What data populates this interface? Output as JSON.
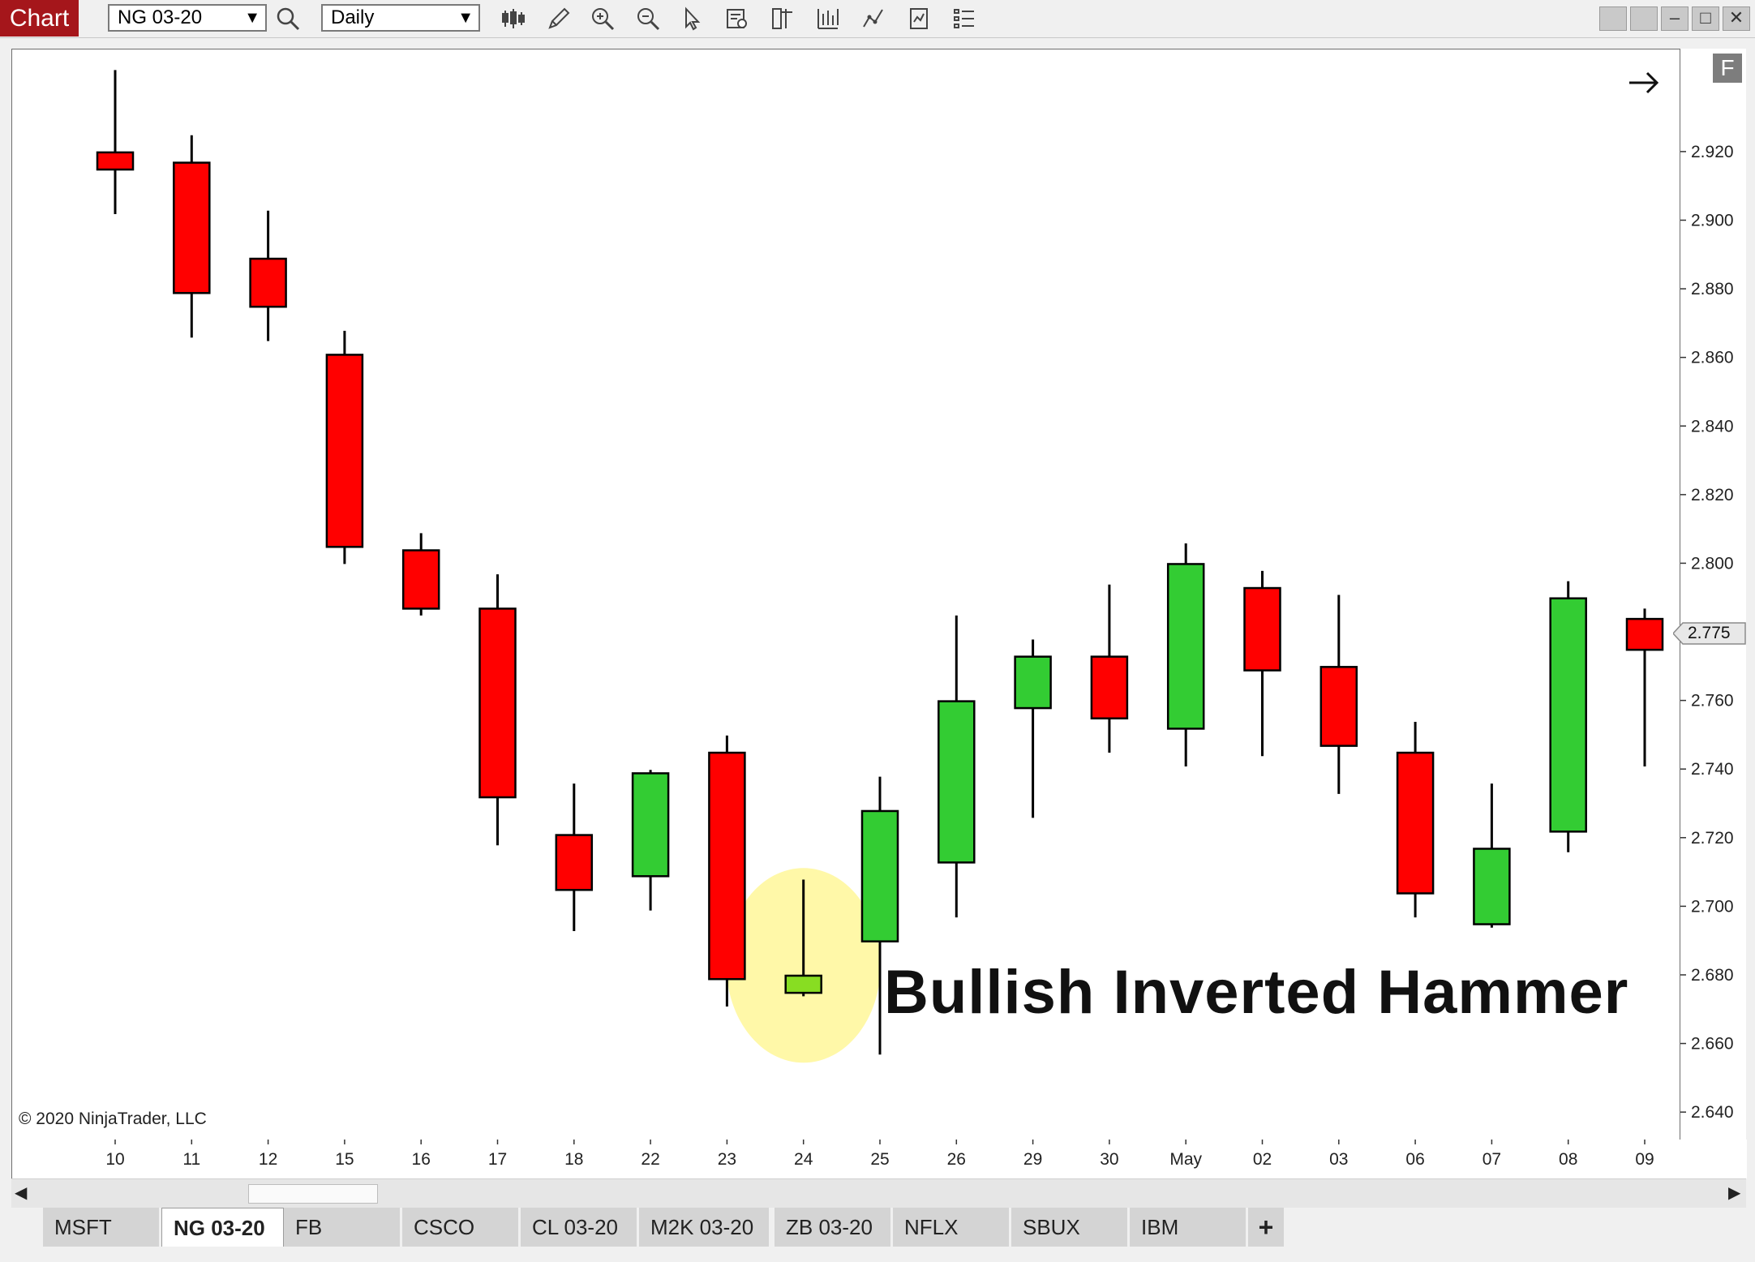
{
  "window": {
    "title_badge": "Chart",
    "instrument": "NG 03-20",
    "interval": "Daily"
  },
  "toolbar_icons": [
    "search-icon",
    "bar-type-icon",
    "pencil-icon",
    "zoom-in-icon",
    "zoom-out-icon",
    "pointer-icon",
    "data-box-icon",
    "chart-trader-icon",
    "indicators-icon",
    "strategies-icon",
    "templates-icon",
    "properties-icon"
  ],
  "window_controls": [
    "link-icon",
    "link-icon-2",
    "minimize-icon",
    "maximize-icon",
    "close-icon"
  ],
  "copyright": "© 2020 NinjaTrader, LLC",
  "f_badge": "F",
  "annotation": "Bullish Inverted Hammer",
  "last_price": "2.775",
  "colors": {
    "up": "#33cc33",
    "down": "#ff0000",
    "highlight_up": "#88dd22",
    "highlight_circle": "#fff799",
    "brand": "#a5161b"
  },
  "chart_data": {
    "type": "candlestick",
    "x_labels": [
      "10",
      "11",
      "12",
      "15",
      "16",
      "17",
      "18",
      "22",
      "23",
      "24",
      "25",
      "26",
      "29",
      "30",
      "May",
      "02",
      "03",
      "06",
      "07",
      "08",
      "09"
    ],
    "y_ticks": [
      "2.640",
      "2.660",
      "2.680",
      "2.700",
      "2.720",
      "2.740",
      "2.760",
      "2.780",
      "2.800",
      "2.820",
      "2.840",
      "2.860",
      "2.880",
      "2.900",
      "2.920"
    ],
    "ylim": [
      2.632,
      2.95
    ],
    "candles": [
      {
        "o": 2.92,
        "h": 2.944,
        "l": 2.902,
        "c": 2.915
      },
      {
        "o": 2.917,
        "h": 2.925,
        "l": 2.866,
        "c": 2.879
      },
      {
        "o": 2.889,
        "h": 2.903,
        "l": 2.865,
        "c": 2.875
      },
      {
        "o": 2.861,
        "h": 2.868,
        "l": 2.8,
        "c": 2.805
      },
      {
        "o": 2.804,
        "h": 2.809,
        "l": 2.785,
        "c": 2.787
      },
      {
        "o": 2.787,
        "h": 2.797,
        "l": 2.718,
        "c": 2.732
      },
      {
        "o": 2.721,
        "h": 2.736,
        "l": 2.693,
        "c": 2.705
      },
      {
        "o": 2.709,
        "h": 2.74,
        "l": 2.699,
        "c": 2.739
      },
      {
        "o": 2.745,
        "h": 2.75,
        "l": 2.671,
        "c": 2.679
      },
      {
        "o": 2.675,
        "h": 2.708,
        "l": 2.674,
        "c": 2.68,
        "highlight": true
      },
      {
        "o": 2.69,
        "h": 2.738,
        "l": 2.657,
        "c": 2.728
      },
      {
        "o": 2.713,
        "h": 2.785,
        "l": 2.697,
        "c": 2.76
      },
      {
        "o": 2.758,
        "h": 2.778,
        "l": 2.726,
        "c": 2.773
      },
      {
        "o": 2.773,
        "h": 2.794,
        "l": 2.745,
        "c": 2.755
      },
      {
        "o": 2.752,
        "h": 2.806,
        "l": 2.741,
        "c": 2.8
      },
      {
        "o": 2.793,
        "h": 2.798,
        "l": 2.744,
        "c": 2.769
      },
      {
        "o": 2.77,
        "h": 2.791,
        "l": 2.733,
        "c": 2.747
      },
      {
        "o": 2.745,
        "h": 2.754,
        "l": 2.697,
        "c": 2.704
      },
      {
        "o": 2.695,
        "h": 2.736,
        "l": 2.694,
        "c": 2.717
      },
      {
        "o": 2.722,
        "h": 2.795,
        "l": 2.716,
        "c": 2.79
      },
      {
        "o": 2.784,
        "h": 2.787,
        "l": 2.741,
        "c": 2.775
      }
    ]
  },
  "tabs": [
    {
      "label": "MSFT",
      "active": false
    },
    {
      "label": "NG 03-20",
      "active": true
    },
    {
      "label": "FB",
      "active": false
    },
    {
      "label": "CSCO",
      "active": false
    },
    {
      "label": "CL 03-20",
      "active": false
    },
    {
      "label": "M2K 03-20",
      "active": false
    },
    {
      "label": "ZB 03-20",
      "active": false
    },
    {
      "label": "NFLX",
      "active": false
    },
    {
      "label": "SBUX",
      "active": false
    },
    {
      "label": "IBM",
      "active": false
    }
  ],
  "add_tab": "+"
}
